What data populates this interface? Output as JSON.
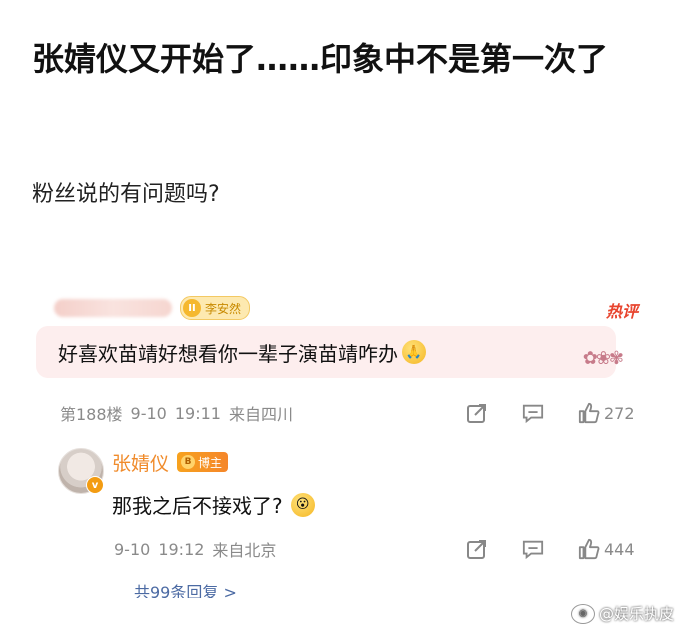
{
  "post": {
    "title": "张婧仪又开始了……印象中不是第一次了",
    "subtitle": "粉丝说的有问题吗?"
  },
  "comment": {
    "fan_badge_label": "李安然",
    "hot_tag": "热评",
    "text": "好喜欢苗靖好想看你一辈子演苗靖咋办",
    "floor": "第188楼",
    "date": "9-10",
    "time": "19:11",
    "location": "来自四川",
    "likes": "272"
  },
  "reply": {
    "author": "张婧仪",
    "badge": "博主",
    "text": "那我之后不接戏了?",
    "date": "9-10",
    "time": "19:12",
    "location": "来自北京",
    "likes": "444"
  },
  "more_replies": "共99条回复 >",
  "watermark": "@娱乐执皮",
  "icons": [
    "share-icon",
    "comment-icon",
    "like-icon",
    "praying-emoji-icon",
    "confused-emoji-icon",
    "weibo-logo-icon"
  ]
}
